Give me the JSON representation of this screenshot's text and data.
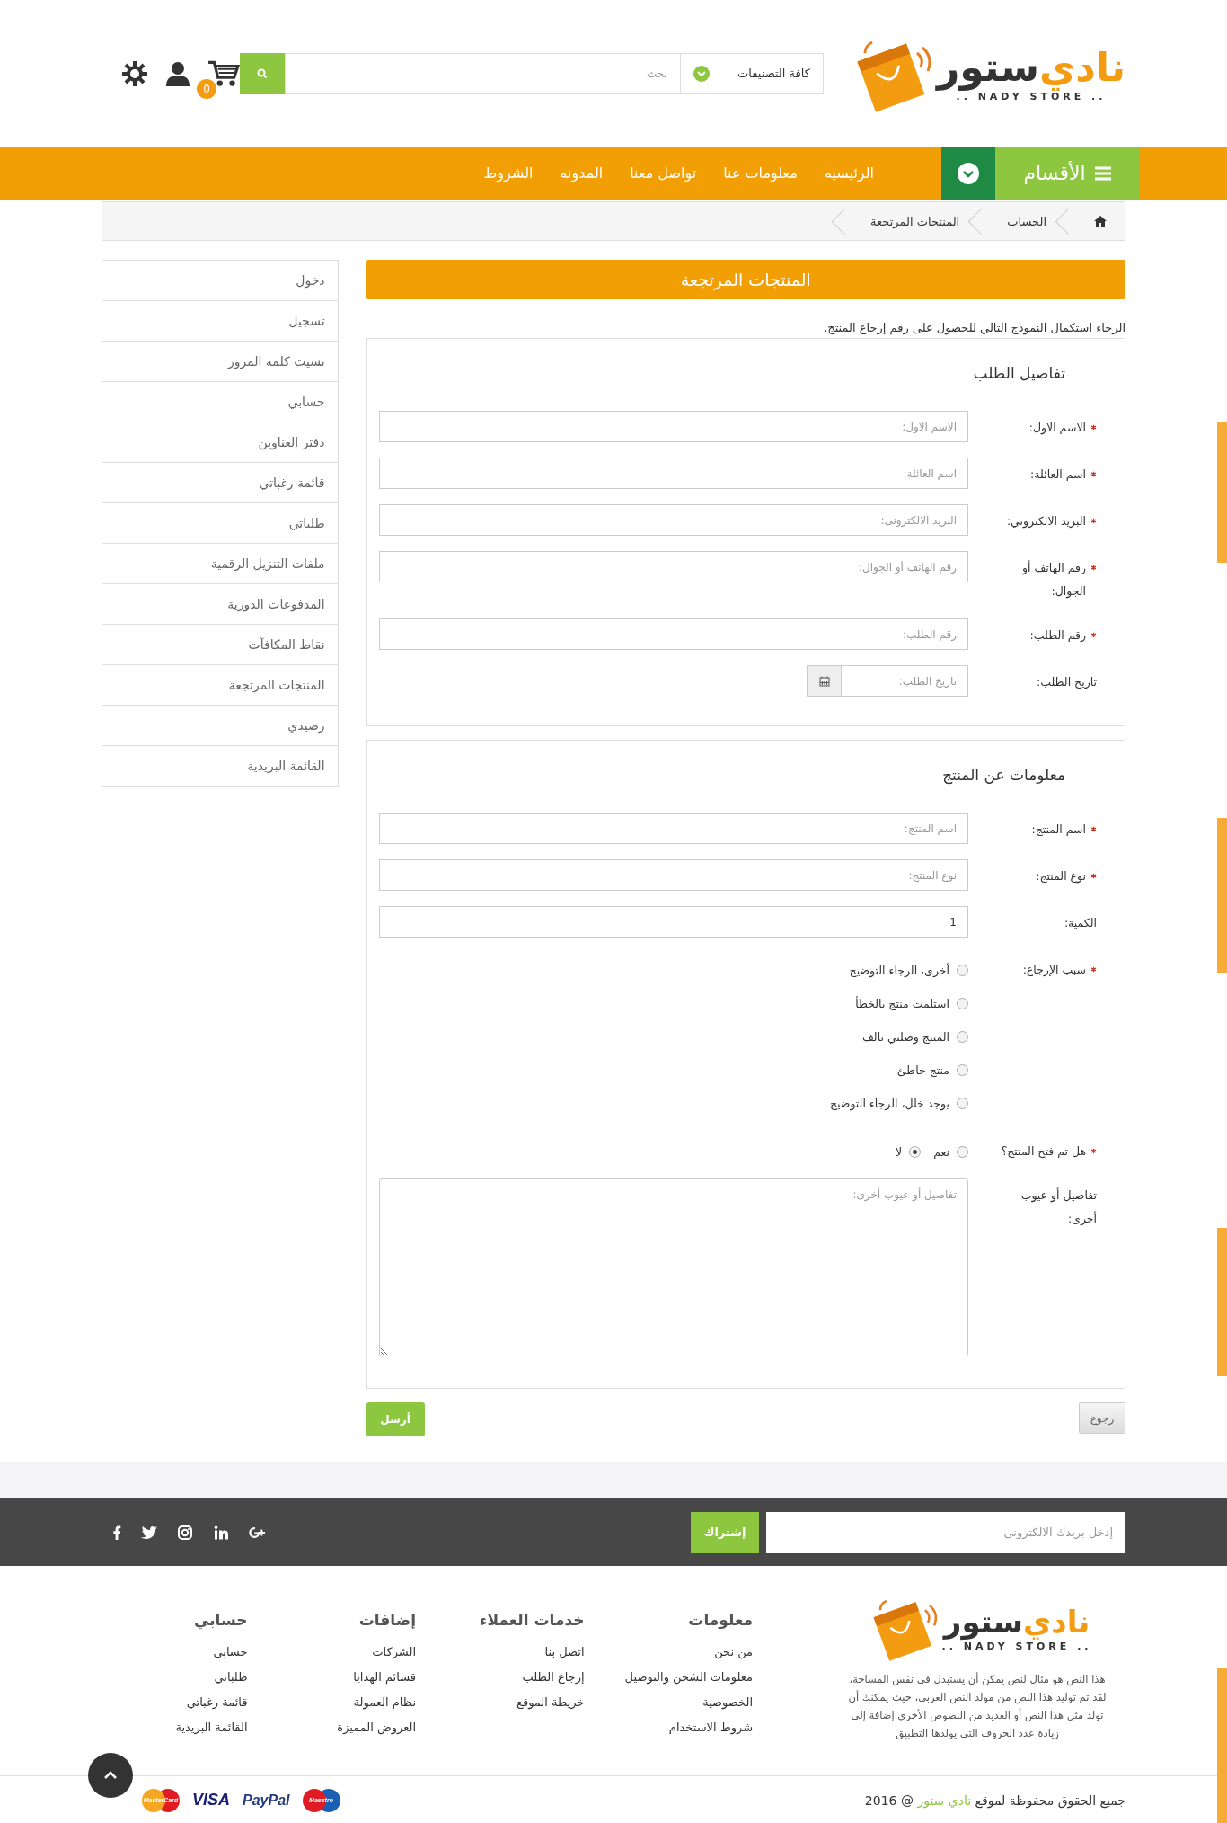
{
  "header": {
    "logo": {
      "words": [
        {
          "text": "نادي",
          "accent": true
        },
        {
          "text": "ستور",
          "accent": false
        }
      ],
      "tagline": ".. NADY STORE .."
    },
    "search": {
      "category": "كافة التصنيفات",
      "placeholder": "بحث"
    },
    "cart_count": "0"
  },
  "nav": {
    "categories_label": "الأقسام",
    "items": [
      "الرئيسيه",
      "معلومات عنا",
      "تواصل معنا",
      "المدونه",
      "الشروط"
    ]
  },
  "breadcrumb": [
    "الحساب",
    "المنتجات المرتجعة"
  ],
  "sidebar": {
    "items": [
      "دخول",
      "تسجيل",
      "نسيت كلمة المرور",
      "حسابي",
      "دفتر العناوين",
      "قائمة رغباتي",
      "طلباتي",
      "ملفات التنزيل الرقمية",
      "المدفوعات الدورية",
      "نقاط المكافآت",
      "المنتجات المرتجعة",
      "رصيدي",
      "القائمة البريدية"
    ]
  },
  "page": {
    "title": "المنتجات المرتجعة",
    "intro": "الرجاء استكمال النموذج التالي للحصول على رقم إرجاع المنتج.",
    "sections": [
      {
        "title": "تفاصيل الطلب",
        "fields": [
          {
            "kind": "text",
            "label": "الاسم الاول:",
            "required": true,
            "placeholder": "الاسم الاول:"
          },
          {
            "kind": "text",
            "label": "اسم العائلة:",
            "required": true,
            "placeholder": "اسم العائلة:"
          },
          {
            "kind": "text",
            "label": "البريد الالكتروني:",
            "required": true,
            "placeholder": "البريد الالكترونى:"
          },
          {
            "kind": "text",
            "label": "رقم الهاتف أو الجوال:",
            "required": true,
            "placeholder": "رقم الهاتف أو الجوال:"
          },
          {
            "kind": "text",
            "label": "رقم الطلب:",
            "required": true,
            "placeholder": "رقم الطلب:"
          },
          {
            "kind": "date",
            "label": "تاريخ الطلب:",
            "required": false,
            "placeholder": "تاريخ الطلب:"
          }
        ]
      },
      {
        "title": "معلومات عن المنتج",
        "fields": [
          {
            "kind": "text",
            "label": "اسم المنتج:",
            "required": true,
            "placeholder": "اسم المنتج:"
          },
          {
            "kind": "text",
            "label": "نوع المنتج:",
            "required": true,
            "placeholder": "نوع المنتج:"
          },
          {
            "kind": "text",
            "label": "الكمية:",
            "required": false,
            "value": "1"
          },
          {
            "kind": "radio-list",
            "label": "سبب الإرجاع:",
            "required": true,
            "options": [
              {
                "label": "أخرى، الرجاء التوضيح",
                "selected": false
              },
              {
                "label": "استلمت منتج بالخطأ",
                "selected": false
              },
              {
                "label": "المنتج وصلني تالف",
                "selected": false
              },
              {
                "label": "منتج خاطئ",
                "selected": false
              },
              {
                "label": "يوجد خلل، الرجاء التوضيح",
                "selected": false
              }
            ]
          },
          {
            "kind": "radio-inline",
            "label": "هل تم فتح المنتج؟",
            "required": true,
            "options": [
              {
                "label": "نعم",
                "selected": false
              },
              {
                "label": "لا",
                "selected": true
              }
            ]
          },
          {
            "kind": "textarea",
            "label": "تفاصيل أو عيوب أخرى:",
            "required": false,
            "placeholder": "تفاصيل أو عيوب أخرى:"
          }
        ]
      }
    ]
  },
  "buttons": {
    "back": "رجوع",
    "submit": "أرسل"
  },
  "newsletter": {
    "placeholder": "إدخل بريدك الالكترونى",
    "button": "إشتراك"
  },
  "footer": {
    "logo": {
      "words": [
        {
          "text": "نادي",
          "accent": true
        },
        {
          "text": "ستور",
          "accent": false
        }
      ],
      "tagline": ".. NADY STORE .."
    },
    "about": "هذا النص هو مثال لنص يمكن أن يستبدل في نفس المساحة، لقد تم توليد هذا النص من مولد النص العربى، حيث يمكنك أن تولد مثل هذا النص أو العديد من النصوص الأخرى إضافة إلى زيادة عدد الحروف التى يولدها التطبيق",
    "columns": [
      {
        "title": "معلومات",
        "links": [
          "من نحن",
          "معلومات الشحن والتوصيل",
          "الخصوصية",
          "شروط الاستخدام"
        ]
      },
      {
        "title": "خدمات العملاء",
        "links": [
          "اتصل بنا",
          "إرجاع الطلب",
          "خريطة الموقع"
        ]
      },
      {
        "title": "إضافات",
        "links": [
          "الشركات",
          "قسائم الهدايا",
          "نظام العمولة",
          "العروض المميزة"
        ]
      },
      {
        "title": "حسابي",
        "links": [
          "حسابي",
          "طلباتي",
          "قائمة رغباتي",
          "القائمة البريدية"
        ]
      }
    ],
    "copyright": {
      "before": "جميع الحقوق محفوظة لموقع",
      "brand": "نادي ستور",
      "after": "@ 2016"
    },
    "payments": [
      {
        "kind": "maestro",
        "label": "Maestro"
      },
      {
        "kind": "paypal",
        "label": "PayPal"
      },
      {
        "kind": "visa",
        "label": "VISA"
      },
      {
        "kind": "mastercard",
        "label": "MasterCard"
      }
    ]
  }
}
